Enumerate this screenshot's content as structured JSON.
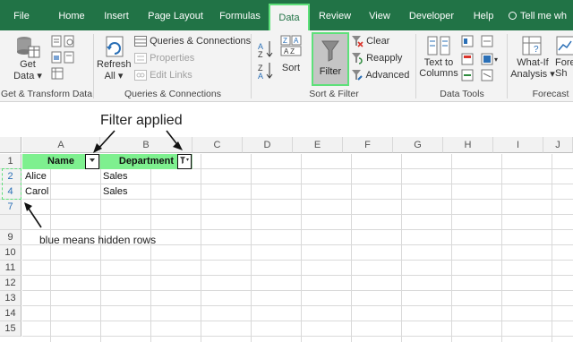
{
  "tabs": [
    {
      "label": "File"
    },
    {
      "label": "Home"
    },
    {
      "label": "Insert"
    },
    {
      "label": "Page Layout"
    },
    {
      "label": "Formulas"
    },
    {
      "label": "Data"
    },
    {
      "label": "Review"
    },
    {
      "label": "View"
    },
    {
      "label": "Developer"
    },
    {
      "label": "Help"
    }
  ],
  "tell_me": "Tell me wh",
  "ribbon": {
    "get_data": "Get",
    "get_data_2": "Data",
    "refresh": "Refresh",
    "refresh_all": "All",
    "queries_connections": "Queries & Connections",
    "properties": "Properties",
    "edit_links": "Edit Links",
    "sort": "Sort",
    "filter": "Filter",
    "clear": "Clear",
    "reapply": "Reapply",
    "advanced": "Advanced",
    "text_to": "Text to",
    "columns": "Columns",
    "what_if": "What-If",
    "analysis": "Analysis",
    "fore": "Fore",
    "sh": "Sh",
    "groups": {
      "get_transform": "Get & Transform Data",
      "queries": "Queries & Connections",
      "sort_filter": "Sort & Filter",
      "data_tools": "Data Tools",
      "forecast": "Forecast"
    }
  },
  "annotations": {
    "filter_applied": "Filter applied",
    "hidden_rows_note": "blue means hidden rows"
  },
  "columns": [
    "A",
    "B",
    "C",
    "D",
    "E",
    "F",
    "G",
    "H",
    "I",
    "J"
  ],
  "rows": [
    "1",
    "2",
    "4",
    "7",
    "9",
    "10",
    "11",
    "12",
    "13",
    "14",
    "15"
  ],
  "table": {
    "headers": [
      "Name",
      "Department"
    ],
    "rows": [
      [
        "Alice",
        "Sales"
      ],
      [
        "Carol",
        "Sales"
      ]
    ]
  },
  "colors": {
    "ribbon_green": "#217346",
    "highlight_green": "#5ee07a",
    "header_fill": "#7ef08f",
    "hidden_row_blue": "#2a6fb6"
  }
}
